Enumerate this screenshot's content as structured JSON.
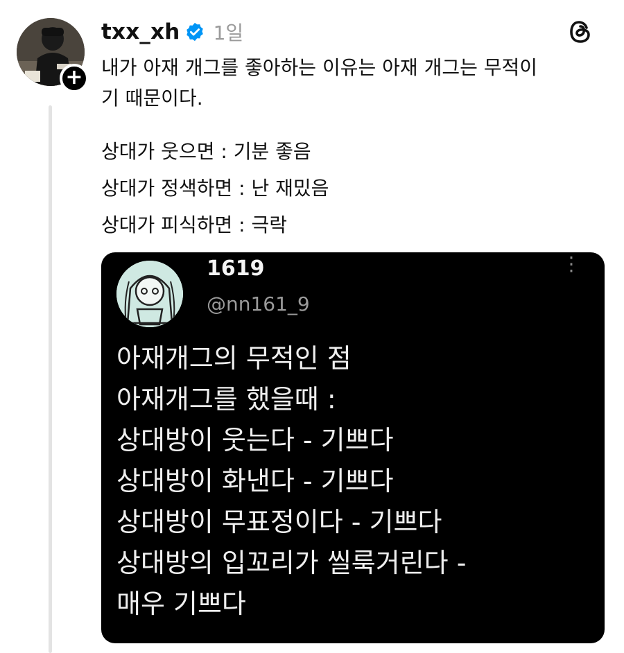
{
  "post": {
    "username": "txx_xh",
    "time": "1일",
    "text_lines": [
      "내가 아재 개그를 좋아하는 이유는 아재 개그는 무적이",
      "기 때문이다."
    ],
    "reaction_lines": [
      "상대가 웃으면 : 기분 좋음",
      "상대가 정색하면 : 난 재밌음",
      "상대가 피식하면 : 극락"
    ]
  },
  "embed": {
    "name": "1619",
    "handle": "@nn161_9",
    "lines": [
      "아재개그의 무적인 점",
      "아재개그를 했을때 :",
      "상대방이 웃는다 - 기쁘다",
      "상대방이 화낸다 - 기쁘다",
      "상대방이 무표정이다 - 기쁘다",
      "상대방의 입꼬리가 씰룩거린다 -",
      "매우 기쁘다"
    ]
  },
  "icons": {
    "verified": "verified-badge-icon",
    "threads": "threads-logo-icon",
    "more": "more-vertical-icon",
    "follow": "plus-icon"
  },
  "colors": {
    "verified_blue": "#0095f6",
    "muted": "#9a9a9a",
    "thread_line": "#e3e3e3",
    "embed_bg": "#000000"
  }
}
